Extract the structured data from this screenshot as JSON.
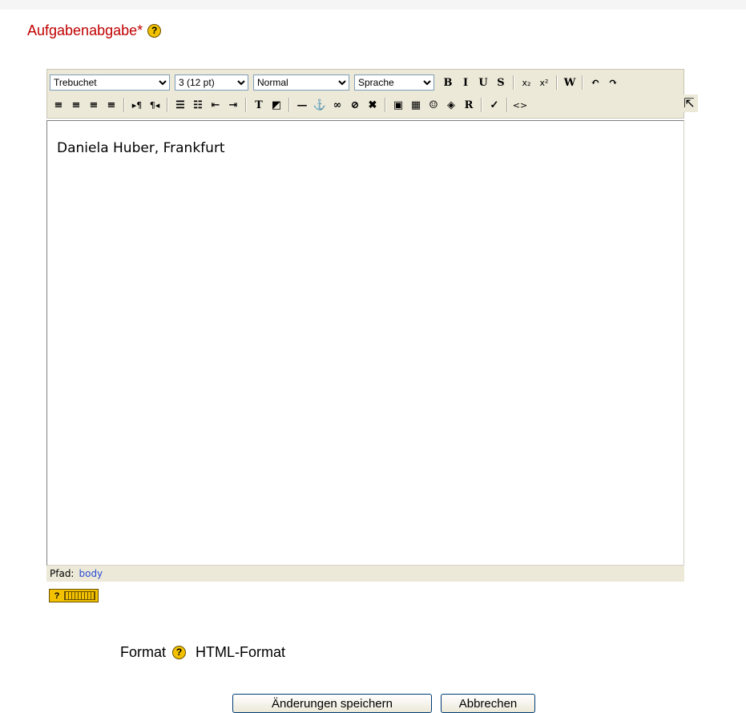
{
  "field": {
    "label": "Aufgabenabgabe*",
    "help_icon": "question-circle-icon",
    "help_glyph": "?"
  },
  "toolbar": {
    "font_family": "Trebuchet",
    "font_size": "3 (12 pt)",
    "block_format": "Normal",
    "language": "Sprache",
    "row1": [
      {
        "name": "bold-button",
        "glyph": "B"
      },
      {
        "name": "italic-button",
        "glyph": "I"
      },
      {
        "name": "underline-button",
        "glyph": "U"
      },
      {
        "name": "strikethrough-button",
        "glyph": "S"
      },
      {
        "name": "sep"
      },
      {
        "name": "subscript-button",
        "glyph": "x₂"
      },
      {
        "name": "superscript-button",
        "glyph": "x²"
      },
      {
        "name": "sep"
      },
      {
        "name": "clean-word-button",
        "glyph": "W"
      },
      {
        "name": "sep"
      },
      {
        "name": "undo-button",
        "glyph": "↶"
      },
      {
        "name": "redo-button",
        "glyph": "↷"
      }
    ],
    "row2": [
      {
        "name": "align-left-button",
        "glyph": "≡"
      },
      {
        "name": "align-center-button",
        "glyph": "≡"
      },
      {
        "name": "align-right-button",
        "glyph": "≡"
      },
      {
        "name": "justify-button",
        "glyph": "≡"
      },
      {
        "name": "sep"
      },
      {
        "name": "ltr-button",
        "glyph": "▸¶"
      },
      {
        "name": "rtl-button",
        "glyph": "¶◂"
      },
      {
        "name": "sep"
      },
      {
        "name": "ordered-list-button",
        "glyph": "☰"
      },
      {
        "name": "unordered-list-button",
        "glyph": "☷"
      },
      {
        "name": "outdent-button",
        "glyph": "⇤"
      },
      {
        "name": "indent-button",
        "glyph": "⇥"
      },
      {
        "name": "sep"
      },
      {
        "name": "text-color-button",
        "glyph": "T"
      },
      {
        "name": "background-color-button",
        "glyph": "◩"
      },
      {
        "name": "sep"
      },
      {
        "name": "horizontal-rule-button",
        "glyph": "—"
      },
      {
        "name": "anchor-button",
        "glyph": "⚓"
      },
      {
        "name": "link-button",
        "glyph": "∞"
      },
      {
        "name": "unlink-button",
        "glyph": "⊘"
      },
      {
        "name": "nolink-button",
        "glyph": "✖"
      },
      {
        "name": "sep"
      },
      {
        "name": "insert-image-button",
        "glyph": "▣"
      },
      {
        "name": "insert-table-button",
        "glyph": "▦"
      },
      {
        "name": "insert-smiley-button",
        "glyph": "☺"
      },
      {
        "name": "insert-char-button",
        "glyph": "◈"
      },
      {
        "name": "search-replace-button",
        "glyph": "R"
      },
      {
        "name": "sep"
      },
      {
        "name": "spellcheck-button",
        "glyph": "✓"
      },
      {
        "name": "sep"
      },
      {
        "name": "html-source-button",
        "glyph": "<>"
      }
    ],
    "fullscreen_glyph": "⇱"
  },
  "editor": {
    "content": "Daniela Huber, Frankfurt"
  },
  "status": {
    "label": "Pfad:",
    "path": "body"
  },
  "keyboard_help": {
    "glyph": "?",
    "icon": "keyboard-icon"
  },
  "format": {
    "label": "Format",
    "value": "HTML-Format",
    "help_glyph": "?"
  },
  "actions": {
    "save": "Änderungen speichern",
    "cancel": "Abbrechen"
  }
}
